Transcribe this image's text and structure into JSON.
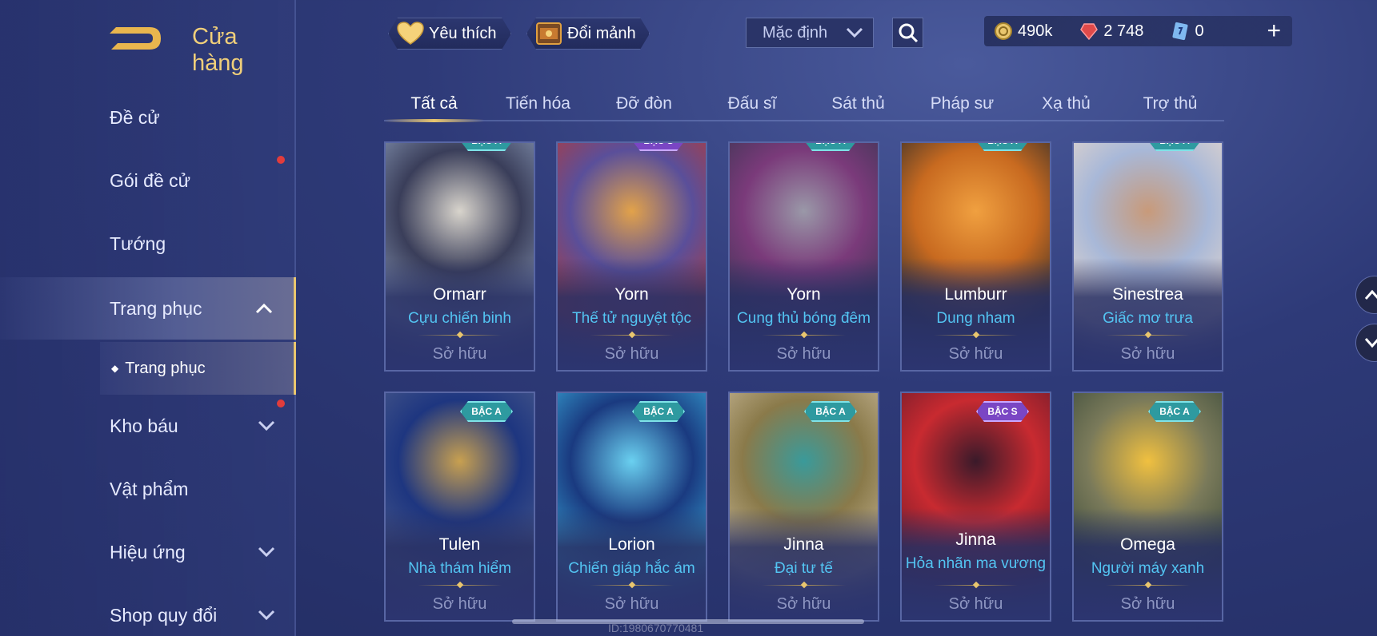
{
  "header": {
    "title": "Cửa hàng",
    "favorite_label": "Yêu thích",
    "exchange_label": "Đổi mảnh",
    "sort_value": "Mặc định",
    "currencies": [
      {
        "icon": "gold-coin-icon",
        "value": "490k"
      },
      {
        "icon": "red-gem-icon",
        "value": "2 748"
      },
      {
        "icon": "voucher-icon",
        "value": "0"
      }
    ],
    "plus_label": "+"
  },
  "sidebar": {
    "items": [
      {
        "label": "Đề cử"
      },
      {
        "label": "Gói đề cử"
      },
      {
        "label": "Tướng"
      },
      {
        "label": "Trang phục"
      },
      {
        "label": "Kho báu"
      },
      {
        "label": "Vật phẩm"
      },
      {
        "label": "Hiệu ứng"
      },
      {
        "label": "Shop quy đổi"
      }
    ],
    "sub_item": "Trang phục",
    "sub_bullet": "◆"
  },
  "tabs": [
    "Tất cả",
    "Tiến hóa",
    "Đỡ đòn",
    "Đấu sĩ",
    "Sát thủ",
    "Pháp sư",
    "Xạ thủ",
    "Trợ thủ"
  ],
  "cards": [
    {
      "hero": "Ormarr",
      "skin": "Cựu chiến binh",
      "status": "Sở hữu",
      "badge": "BẬC A",
      "art": [
        "#8a9ab8",
        "#3a3e5a",
        "#d8d4cc"
      ]
    },
    {
      "hero": "Yorn",
      "skin": "Thế tử nguyệt tộc",
      "status": "Sở hữu",
      "badge": "BẬC S",
      "art": [
        "#b43a3a",
        "#5a4f9a",
        "#e2a24a"
      ]
    },
    {
      "hero": "Yorn",
      "skin": "Cung thủ bóng đêm",
      "status": "Sở hữu",
      "badge": "BẬC A",
      "art": [
        "#3a3552",
        "#7a3a7a",
        "#9a98a8"
      ]
    },
    {
      "hero": "Lumburr",
      "skin": "Dung nham",
      "status": "Sở hữu",
      "badge": "BẬC A",
      "art": [
        "#2a2a2a",
        "#c86a20",
        "#f0a040"
      ]
    },
    {
      "hero": "Sinestrea",
      "skin": "Giấc mơ trưa",
      "status": "Sở hữu",
      "badge": "BẬC A",
      "art": [
        "#e8d8cc",
        "#a8b8d8",
        "#c89a7a"
      ]
    },
    {
      "hero": "Tulen",
      "skin": "Nhà thám hiểm",
      "status": "Sở hữu",
      "badge": "BẬC A",
      "art": [
        "#4a5a8a",
        "#1e3680",
        "#c8a050"
      ]
    },
    {
      "hero": "Lorion",
      "skin": "Chiến giáp hắc ám",
      "status": "Sở hữu",
      "badge": "BẬC A",
      "art": [
        "#38a8d8",
        "#1a3a80",
        "#6ad0f0"
      ]
    },
    {
      "hero": "Jinna",
      "skin": "Đại tư tế",
      "status": "Sở hữu",
      "badge": "BẬC A",
      "art": [
        "#c8b898",
        "#8a7a4a",
        "#3a9a9a"
      ]
    },
    {
      "hero": "Jinna",
      "skin": "Hỏa nhãn ma vương",
      "status": "Sở hữu",
      "badge": "BẬC S",
      "art": [
        "#6a1a2a",
        "#c82a30",
        "#3a1a2a"
      ]
    },
    {
      "hero": "Omega",
      "skin": "Người máy xanh",
      "status": "Sở hữu",
      "badge": "BẬC A",
      "art": [
        "#3a4a3a",
        "#7a7a5a",
        "#f0c040"
      ]
    }
  ],
  "watermark": "ID:1980670770481"
}
